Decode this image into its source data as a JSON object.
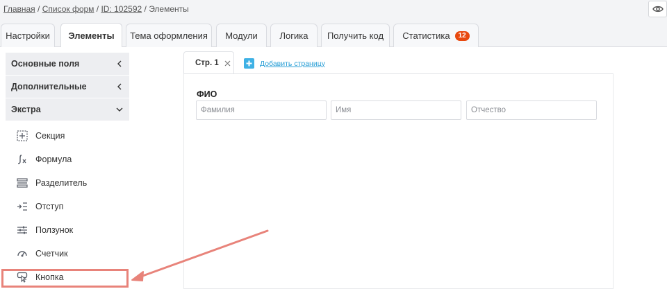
{
  "breadcrumb": {
    "home": "Главная",
    "sep1": " / ",
    "forms": "Список форм",
    "sep2": " / ",
    "id": "ID: 102592",
    "sep3": " / ",
    "current": "Элементы"
  },
  "tabs": [
    {
      "label": "Настройки"
    },
    {
      "label": "Элементы",
      "active": true
    },
    {
      "label": "Тема оформления"
    },
    {
      "label": "Модули"
    },
    {
      "label": "Логика"
    },
    {
      "label": "Получить код"
    },
    {
      "label": "Статистика",
      "badge": "12"
    }
  ],
  "sidebar": {
    "sections": [
      {
        "label": "Основные поля",
        "state": "collapsed"
      },
      {
        "label": "Дополнительные",
        "state": "collapsed"
      },
      {
        "label": "Экстра",
        "state": "expanded"
      }
    ],
    "items": [
      {
        "label": "Секция",
        "icon": "section-icon"
      },
      {
        "label": "Формула",
        "icon": "formula-icon"
      },
      {
        "label": "Разделитель",
        "icon": "divider-icon"
      },
      {
        "label": "Отступ",
        "icon": "indent-icon"
      },
      {
        "label": "Ползунок",
        "icon": "slider-icon"
      },
      {
        "label": "Счетчик",
        "icon": "counter-icon"
      },
      {
        "label": "Кнопка",
        "icon": "button-icon",
        "highlighted": true
      }
    ]
  },
  "canvas": {
    "page_tab": "Стр. 1",
    "add_page": "Добавить страницу",
    "field_label": "ФИО",
    "inputs": [
      {
        "placeholder": "Фамилия"
      },
      {
        "placeholder": "Имя"
      },
      {
        "placeholder": "Отчество"
      }
    ]
  },
  "colors": {
    "accent": "#3fb1e5",
    "badge": "#e8490f",
    "annotation": "#e8837a"
  }
}
